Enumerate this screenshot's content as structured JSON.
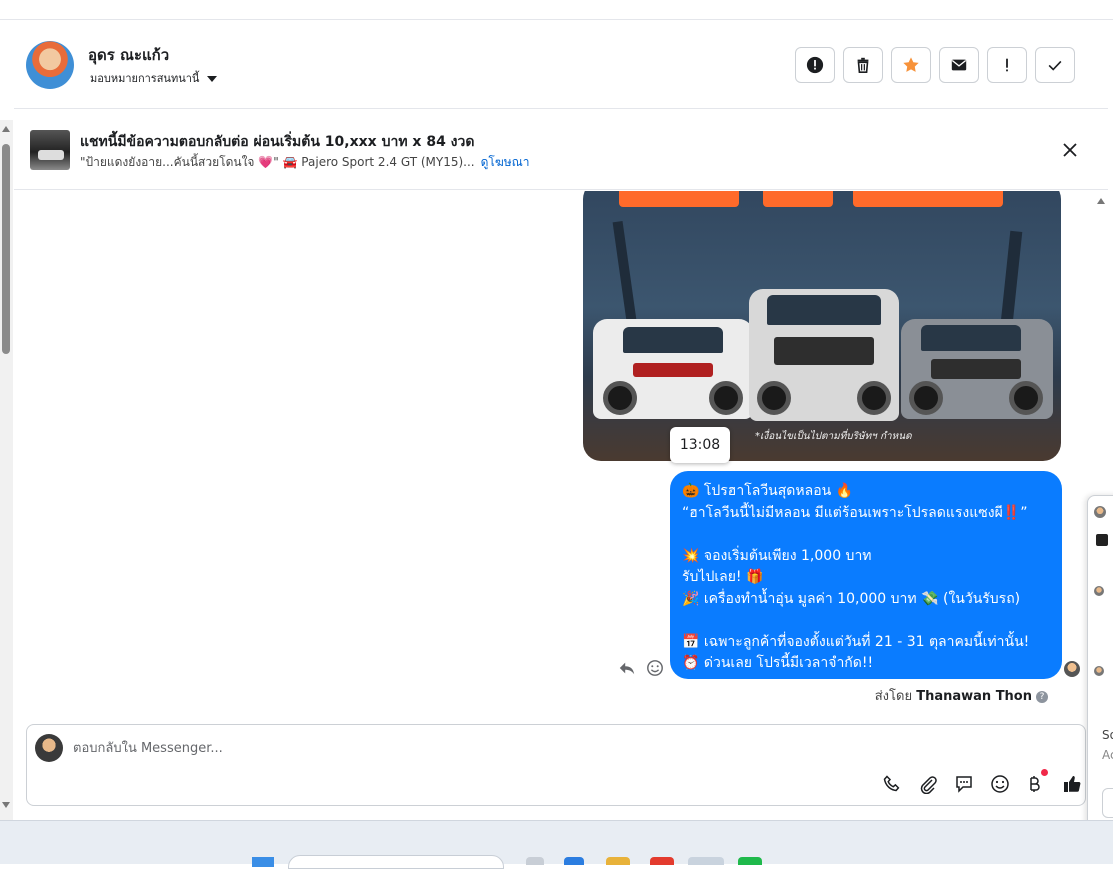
{
  "header": {
    "name": "อุดร ณะแก้ว",
    "subtitle": "มอบหมายการสนทนานี้",
    "actions": [
      {
        "id": "spam",
        "icon": "alert-circle-icon"
      },
      {
        "id": "delete",
        "icon": "trash-icon"
      },
      {
        "id": "star",
        "icon": "star-icon"
      },
      {
        "id": "unread",
        "icon": "envelope-icon"
      },
      {
        "id": "follow-up",
        "icon": "exclamation-icon"
      },
      {
        "id": "done",
        "icon": "check-icon"
      }
    ],
    "star_color": "#f7923a"
  },
  "ad": {
    "title": "แชทนี้มีข้อความตอบกลับต่อ ผ่อนเริ่มต้น 10,xxx บาท x 84 งวด",
    "subtitle": "\"ป้ายแดงยังอาย...คันนี้สวยโดนใจ 💗\" 🚘 Pajero Sport 2.4 GT (MY15)...",
    "link": "ดูโฆษณา"
  },
  "message": {
    "image_note": "*เงื่อนไขเป็นไปตามที่บริษัทฯ กำหนด",
    "timestamp": "13:08",
    "lines": [
      "🎃 โปรฮาโลวีนสุดหลอน 🔥",
      "“ฮาโลวีนนี้ไม่มีหลอน มีแต่ร้อนเพราะโปรลดแรงแซงผี‼️”",
      "",
      "💥 จองเริ่มต้นเพียง 1,000 บาท",
      "รับไปเลย! 🎁",
      "🎉 เครื่องทำน้ำอุ่น มูลค่า 10,000 บาท 💸 (ในวันรับรถ)",
      "",
      "📅 เฉพาะลูกค้าที่จองตั้งแต่วันที่ 21 - 31 ตุลาคมนี้เท่านั้น!",
      "⏰ ด่วนเลย โปรนี้มีเวลาจำกัด!!"
    ],
    "bubble_color": "#0a7cff",
    "sent_by_prefix": "ส่งโดย",
    "sent_by_name": "Thanawan Thon"
  },
  "composer": {
    "placeholder": "ตอบกลับใน Messenger...",
    "tools": [
      "phone-icon",
      "paperclip-icon",
      "chat-bubble-icon",
      "emoji-icon",
      "baht-icon",
      "thumbs-up-icon"
    ]
  },
  "popover": {
    "text_a": "So",
    "text_b": "Ac"
  }
}
